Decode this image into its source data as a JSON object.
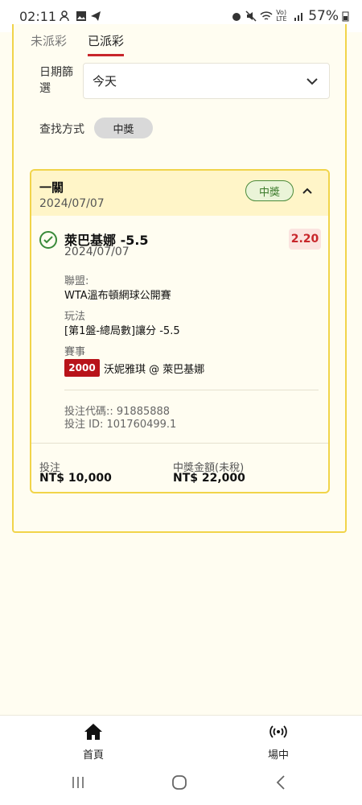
{
  "status_bar": {
    "time": "02:11",
    "battery": "57%",
    "signal_text": "Vo) LTE"
  },
  "tabs": [
    {
      "label": "未派彩",
      "active": false
    },
    {
      "label": "已派彩",
      "active": true
    }
  ],
  "filters": {
    "date_label": "日期篩選",
    "date_value": "今天",
    "find_label": "查找方式",
    "find_value": "中獎"
  },
  "bet": {
    "type": "一關",
    "date": "2024/07/07",
    "status": "中獎",
    "selection": "萊巴基娜 -5.5",
    "selection_date": "2024/07/07",
    "odds": "2.20",
    "league_label": "聯盟:",
    "league_value": "WTA溫布頓網球公開賽",
    "market_label": "玩法",
    "market_value": "[第1盤-總局數]讓分 -5.5",
    "event_label": "賽事",
    "event_id": "2000",
    "event_name": "沃妮雅琪 @ 萊巴基娜",
    "bet_code": "投注代碼:: 91885888",
    "bet_id": "投注 ID: 101760499.1",
    "stake_label": "投注",
    "stake_value": "NT$ 10,000",
    "payout_label": "中獎金額(未稅)",
    "payout_value": "NT$ 22,000"
  },
  "bottom_nav": [
    {
      "label": "首頁",
      "icon": "home-icon"
    },
    {
      "label": "場中",
      "icon": "live-broadcast-icon"
    }
  ],
  "colors": {
    "accent_red": "#c8262b",
    "card_border": "#f1d44a",
    "won_green": "#3a7a2a"
  }
}
